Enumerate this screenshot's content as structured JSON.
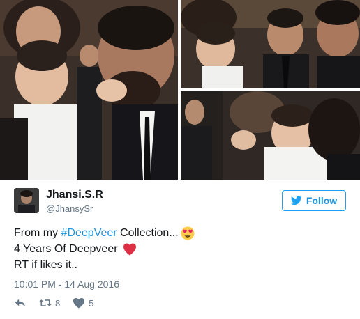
{
  "photos": [
    {
      "name": "photo-main"
    },
    {
      "name": "photo-top-right"
    },
    {
      "name": "photo-bottom-right"
    }
  ],
  "author": {
    "display_name": "Jhansi.S.R",
    "screen_name": "@JhansySr",
    "avatar_icon": "user-avatar"
  },
  "follow_button": {
    "label": "Follow",
    "icon": "twitter-bird-icon",
    "color": "#1da1f2"
  },
  "tweet": {
    "line1_prefix": "From my ",
    "hashtag": "#DeepVeer",
    "line1_suffix": " Collection...",
    "line1_emoji": "heart-eyes-emoji",
    "line2_text": "4 Years Of Deepveer ",
    "line2_emoji": "red-heart-emoji",
    "line3_text": "RT if likes it.."
  },
  "timestamp": "10:01 PM - 14 Aug 2016",
  "actions": {
    "reply_icon": "reply-icon",
    "retweet_icon": "retweet-icon",
    "retweet_count": "8",
    "like_icon": "heart-icon",
    "like_count": "5"
  },
  "colors": {
    "link": "#1b95e0",
    "muted": "#657786",
    "text": "#14171a",
    "heart": "#e0245e"
  }
}
